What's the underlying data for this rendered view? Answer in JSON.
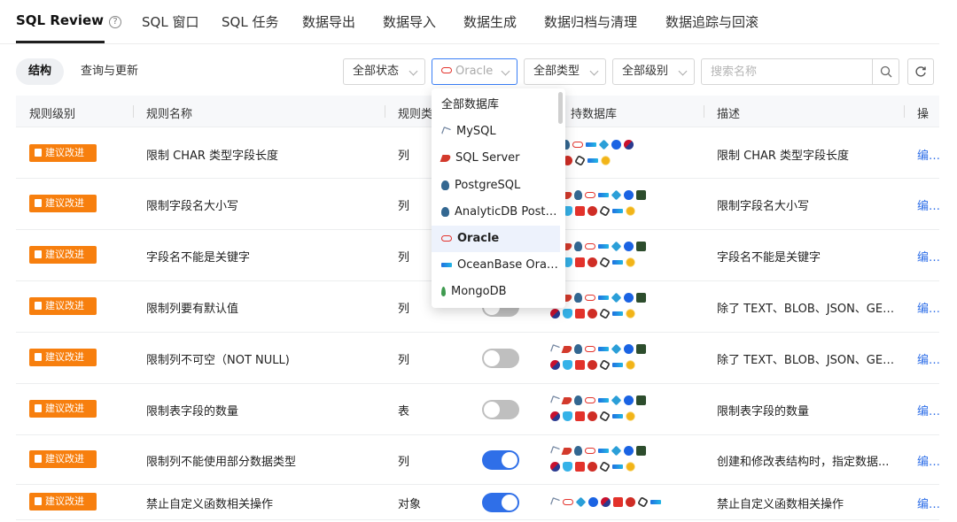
{
  "top_tabs": [
    {
      "label": "SQL Review",
      "active": true
    },
    {
      "label": "SQL 窗口"
    },
    {
      "label": "SQL 任务"
    },
    {
      "label": "数据导出"
    },
    {
      "label": "数据导入"
    },
    {
      "label": "数据生成"
    },
    {
      "label": "数据归档与清理"
    },
    {
      "label": "数据追踪与回滚"
    }
  ],
  "help_icon_glyph": "?",
  "segment": [
    {
      "label": "结构",
      "active": true
    },
    {
      "label": "查询与更新"
    }
  ],
  "filters": {
    "status": "全部状态",
    "database": "Oracle",
    "type": "全部类型",
    "level": "全部级别"
  },
  "search": {
    "placeholder": "搜索名称"
  },
  "table": {
    "columns": [
      "规则级别",
      "规则名称",
      "规则类",
      "持数据库",
      "描述",
      "操"
    ],
    "rows": [
      {
        "level": "建议改进",
        "name": "限制 CHAR 类型字段长度",
        "category": "列",
        "toggle": "hidden",
        "desc": "限制 CHAR 类型字段长度",
        "action": "编辑"
      },
      {
        "level": "建议改进",
        "name": "限制字段名大小写",
        "category": "列",
        "toggle": "hidden",
        "desc": "限制字段名大小写",
        "action": "编辑"
      },
      {
        "level": "建议改进",
        "name": "字段名不能是关键字",
        "category": "列",
        "toggle": "hidden",
        "desc": "字段名不能是关键字",
        "action": "编辑"
      },
      {
        "level": "建议改进",
        "name": "限制列要有默认值",
        "category": "列",
        "toggle": "off",
        "desc": "除了 TEXT、BLOB、JSON、GEO...",
        "action": "编辑"
      },
      {
        "level": "建议改进",
        "name": "限制列不可空（NOT NULL)",
        "category": "列",
        "toggle": "off",
        "desc": "除了 TEXT、BLOB、JSON、GEO...",
        "action": "编辑"
      },
      {
        "level": "建议改进",
        "name": "限制表字段的数量",
        "category": "表",
        "toggle": "off",
        "desc": "限制表字段的数量",
        "action": "编辑"
      },
      {
        "level": "建议改进",
        "name": "限制列不能使用部分数据类型",
        "category": "列",
        "toggle": "on",
        "desc": "创建和修改表结构时，指定数据...",
        "action": "编辑"
      },
      {
        "level": "建议改进",
        "name": "禁止自定义函数相关操作",
        "category": "对象",
        "toggle": "on",
        "desc": "禁止自定义函数相关操作",
        "action": "编辑"
      }
    ]
  },
  "db_icon_rows": {
    "row1_line1": [
      "sqlserver",
      "pg",
      "oracle",
      "ob",
      "polar",
      "tidb",
      "redis"
    ],
    "row1_line2": [
      "red",
      "hbase",
      "hexa",
      "ob",
      "sun"
    ],
    "full_line1": [
      "mysql",
      "sqlserver",
      "pg",
      "oracle",
      "ob",
      "polar",
      "tidb",
      "db2"
    ],
    "full_line2": [
      "redis",
      "cmdb",
      "red",
      "hbase",
      "hexa",
      "ob",
      "sun"
    ],
    "last_line": [
      "mysql",
      "oracle",
      "polar",
      "tidb",
      "redis",
      "red",
      "hbase",
      "hexa",
      "ob"
    ]
  },
  "dropdown": {
    "items": [
      {
        "label": "全部数据库",
        "icon": ""
      },
      {
        "label": "MySQL",
        "icon": "mysql"
      },
      {
        "label": "SQL Server",
        "icon": "sqlserver"
      },
      {
        "label": "PostgreSQL",
        "icon": "pg"
      },
      {
        "label": "AnalyticDB Postg...",
        "icon": "pg"
      },
      {
        "label": "Oracle",
        "icon": "oracle",
        "selected": true
      },
      {
        "label": "OceanBase Oracle",
        "icon": "ob"
      },
      {
        "label": "MongoDB",
        "icon": "mongo"
      }
    ]
  },
  "colors": {
    "accent": "#2f6fe8",
    "badge": "#f77f0e",
    "oracle": "#e3322b"
  }
}
